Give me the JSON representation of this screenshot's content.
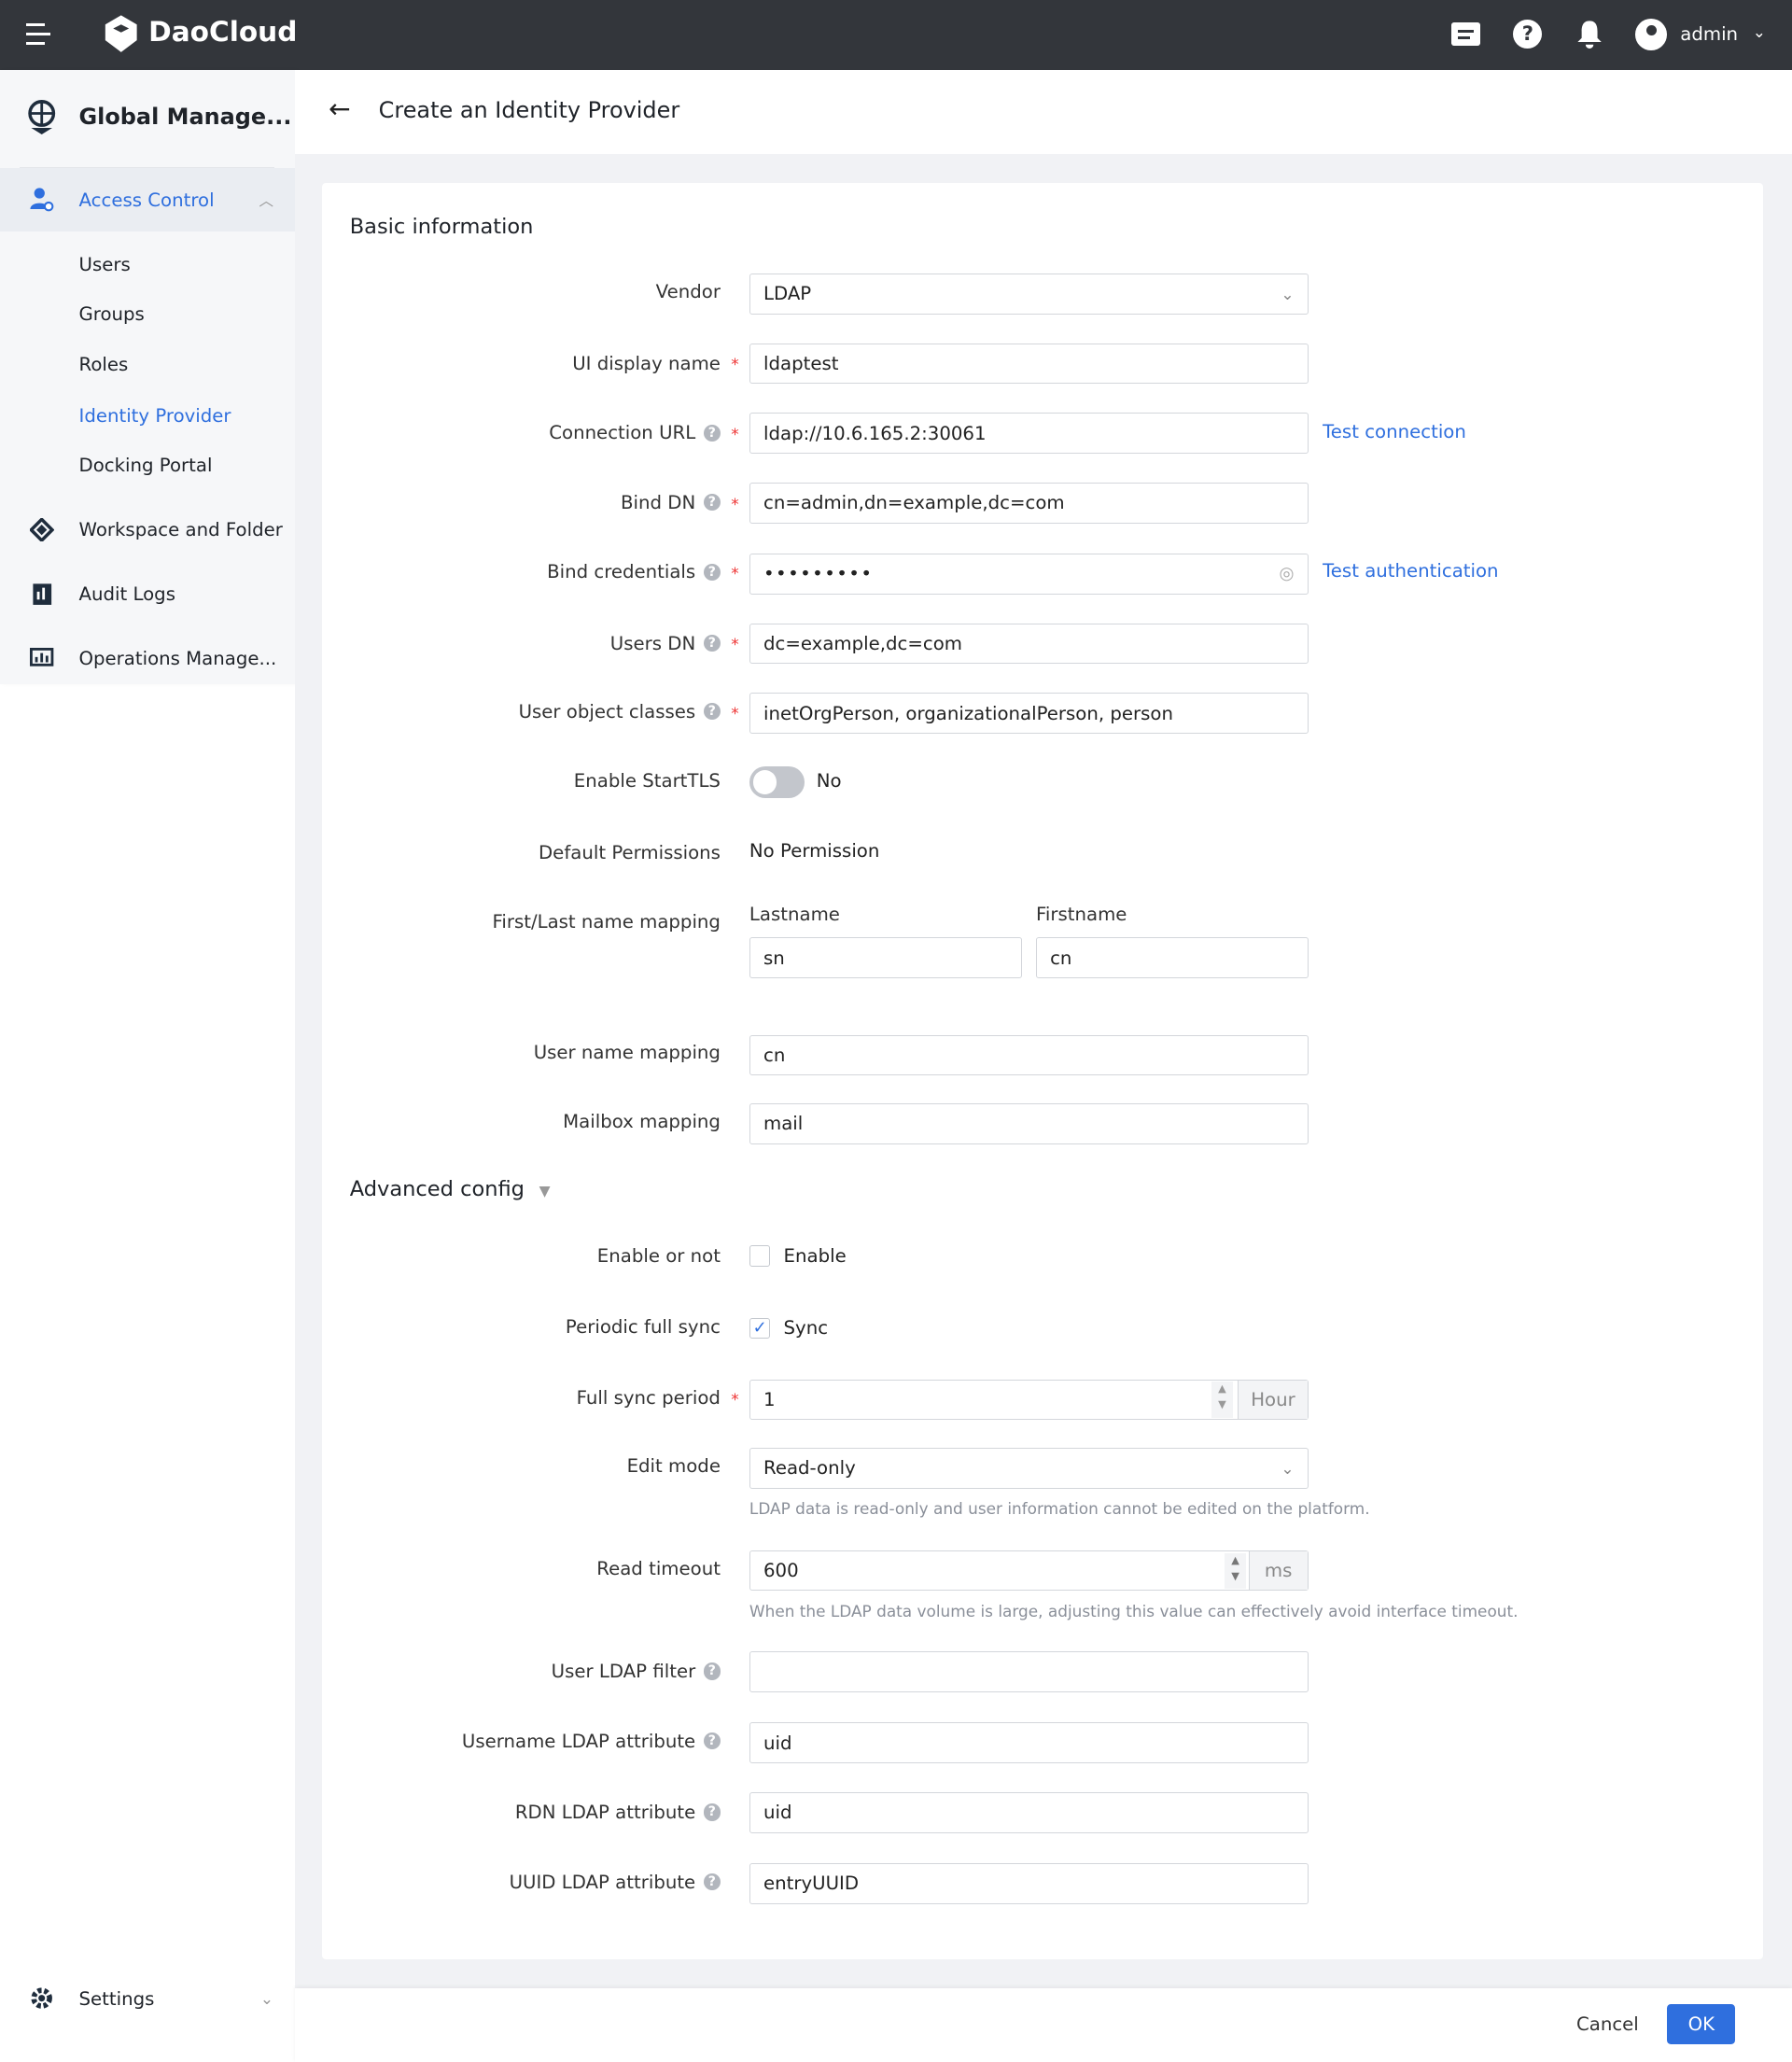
{
  "header": {
    "brand": "DaoCloud",
    "user": "admin",
    "icons": [
      "menu-icon",
      "logo-icon",
      "message-icon",
      "help-icon",
      "bell-icon",
      "user-avatar-icon",
      "chevron-down-icon"
    ]
  },
  "sidebar": {
    "module": "Global Manage...",
    "items": [
      {
        "label": "Access Control",
        "active": true,
        "children": [
          "Users",
          "Groups",
          "Roles",
          "Identity Provider",
          "Docking Portal"
        ],
        "active_child": "Identity Provider"
      },
      {
        "label": "Workspace and Folder"
      },
      {
        "label": "Audit Logs"
      },
      {
        "label": "Operations Manage..."
      }
    ],
    "settings": "Settings"
  },
  "page": {
    "title": "Create an Identity Provider"
  },
  "basic": {
    "heading": "Basic information",
    "vendor": {
      "label": "Vendor",
      "value": "LDAP"
    },
    "display_name": {
      "label": "UI display name",
      "value": "ldaptest"
    },
    "connection_url": {
      "label": "Connection URL",
      "value": "ldap://10.6.165.2:30061",
      "action": "Test connection"
    },
    "bind_dn": {
      "label": "Bind DN",
      "value": "cn=admin,dn=example,dc=com"
    },
    "bind_credentials": {
      "label": "Bind credentials",
      "value": "•••••••••",
      "action": "Test authentication"
    },
    "users_dn": {
      "label": "Users DN",
      "value": "dc=example,dc=com"
    },
    "user_object_classes": {
      "label": "User object classes",
      "value": "inetOrgPerson, organizationalPerson, person"
    },
    "starttls": {
      "label": "Enable StartTLS",
      "value": "No",
      "on": false
    },
    "default_permissions": {
      "label": "Default Permissions",
      "value": "No Permission"
    },
    "name_mapping": {
      "label": "First/Last name mapping",
      "last_label": "Lastname",
      "last_value": "sn",
      "first_label": "Firstname",
      "first_value": "cn"
    },
    "username_mapping": {
      "label": "User name mapping",
      "value": "cn"
    },
    "mailbox_mapping": {
      "label": "Mailbox mapping",
      "value": "mail"
    }
  },
  "advanced": {
    "heading": "Advanced config",
    "enable": {
      "label": "Enable or not",
      "option": "Enable",
      "checked": false
    },
    "periodic": {
      "label": "Periodic full sync",
      "option": "Sync",
      "checked": true
    },
    "period": {
      "label": "Full sync period",
      "value": "1",
      "unit": "Hour"
    },
    "edit_mode": {
      "label": "Edit mode",
      "value": "Read-only",
      "hint": "LDAP data is read-only and user information cannot be edited on the platform."
    },
    "read_timeout": {
      "label": "Read timeout",
      "value": "600",
      "unit": "ms",
      "hint": "When the LDAP data volume is large, adjusting this value can effectively avoid interface timeout."
    },
    "user_filter": {
      "label": "User LDAP filter",
      "value": ""
    },
    "username_attr": {
      "label": "Username LDAP attribute",
      "value": "uid"
    },
    "rdn_attr": {
      "label": "RDN LDAP attribute",
      "value": "uid"
    },
    "uuid_attr": {
      "label": "UUID LDAP attribute",
      "value": "entryUUID"
    }
  },
  "footer": {
    "cancel": "Cancel",
    "ok": "OK"
  },
  "colors": {
    "accent": "#2f6fde",
    "header": "#33363b",
    "background": "#f1f2f5",
    "required": "#e33333"
  }
}
